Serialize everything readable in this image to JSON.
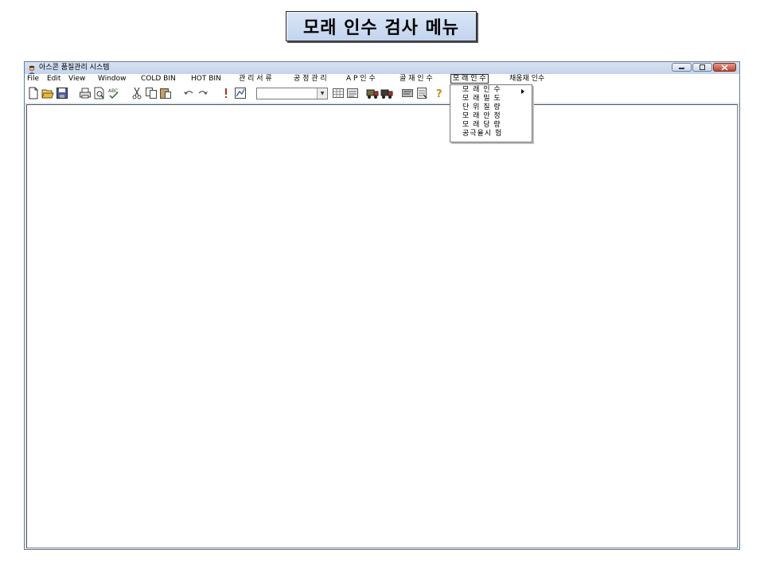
{
  "caption": "모래 인수 검사 메뉴",
  "window": {
    "title": "아스콘 품질관리 시스템",
    "icon": "user-app-icon"
  },
  "menubar": {
    "items": [
      "File",
      "Edit",
      "View",
      "Window",
      "COLD BIN",
      "HOT BIN",
      "관 리 서 류",
      "공 정 관 리",
      "A P  인 수",
      "골 재  인 수",
      "모 래  인 수",
      "채움재 인수"
    ],
    "active": "모 래  인 수"
  },
  "dropdown": {
    "items": [
      "모 래  인 수",
      "모 래  밀 도",
      "단 위  질 량",
      "모 래  안 정",
      "모 래  당 량",
      "공극율시 험"
    ],
    "submenu_index": 0
  },
  "toolbar": {
    "icons": [
      "new-icon",
      "open-icon",
      "save-icon",
      "print-icon",
      "print-preview-icon",
      "spell-check-icon",
      "cut-icon",
      "copy-icon",
      "paste-icon",
      "undo-icon",
      "redo-icon",
      "exclamation-icon",
      "edit-chart-icon",
      "combo-box",
      "table-icon",
      "sheet-icon",
      "truck-icon",
      "truck2-icon",
      "report-icon",
      "document-icon",
      "help-icon"
    ],
    "combo_value": ""
  },
  "colors": {
    "caption_bg": "#c8d8ef",
    "titlebar": "#cfdcee",
    "close_button": "#c9503a"
  }
}
